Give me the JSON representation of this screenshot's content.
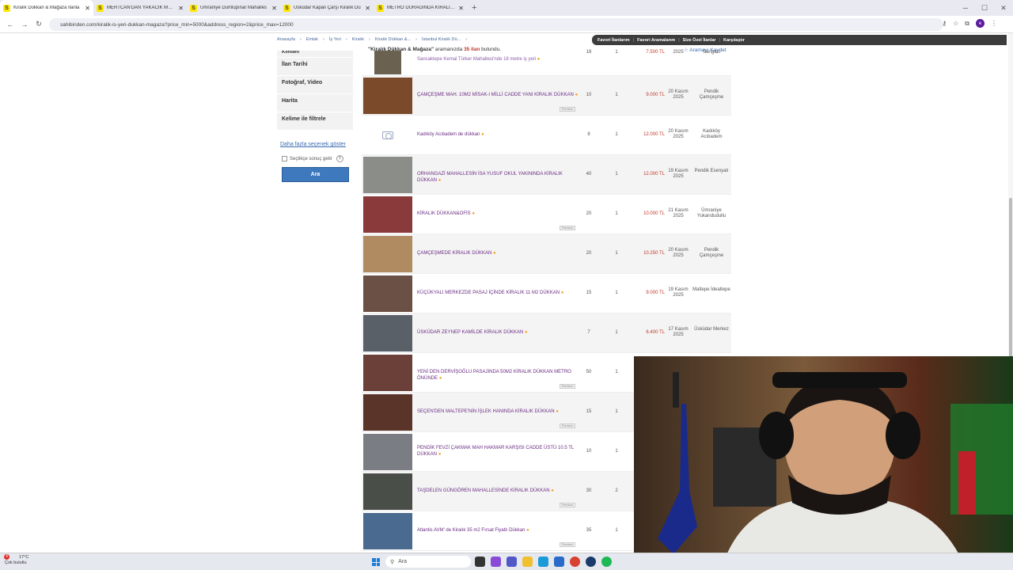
{
  "browser": {
    "tabs": [
      {
        "label": "Kiralık Dükkan & Mağaza İlanla",
        "active": true
      },
      {
        "label": "MERTCAN'DAN YAKACIK MEYD",
        "active": false
      },
      {
        "label": "Ümraniye Dumlupınar Mahalles",
        "active": false
      },
      {
        "label": "Üsküdar Kapalı Çarşı Kiralık Dü",
        "active": false
      },
      {
        "label": "METRO DURAĞINDA KİRALIK D",
        "active": false
      }
    ],
    "url": "sahibinden.com/kiralik-is-yeri-dukkan-magaza?price_min=5000&address_region=2&price_max=12000"
  },
  "breadcrumbs": [
    "Anasayfa",
    "Emlak",
    "İş Yeri",
    "Kiralık",
    "Kiralık Dükkan &...",
    "İstanbul Kiralık Dü..."
  ],
  "topbar": [
    "Favori İlanlarım",
    "Favori Aramalarım",
    "Size Özel İlanlar",
    "Karşılaştır"
  ],
  "result": {
    "query": "\"Kiralık Dükkan & Mağaza\"",
    "middle": "aramanızda",
    "count": "35 ilan",
    "suffix": "bulundu."
  },
  "save_search": "Aramayı Kaydet",
  "sidebar": {
    "items": [
      "Kimden",
      "İlan Tarihi",
      "Fotoğraf, Video",
      "Harita",
      "Kelime ile filtrele"
    ],
    "more_link": "Daha fazla seçenek göster",
    "checkbox_label": "Seçtikçe sonuç getir",
    "help": "?",
    "search_button": "Ara"
  },
  "listings": [
    {
      "title": "Sancaktepe Kemal Türker Mahallesi'nde 18 metre iş yeri",
      "m2": "18",
      "rooms": "1",
      "price": "7.500 TL",
      "date": "2025",
      "loc": "Sarıgazi",
      "photo": "#6a6150",
      "premium": ""
    },
    {
      "title": "ÇAMÇEŞME MAH. 10M2 MİSAK-I MİLLİ CADDE YANI KİRALIK DÜKKAN",
      "m2": "10",
      "rooms": "1",
      "price": "9.000 TL",
      "date": "20 Kasım 2025",
      "loc": "Pendik Çamçeşme",
      "photo": "#7a4a2a",
      "premium": "Premium"
    },
    {
      "title": "Kadıköy Acıbadem de dükkan",
      "m2": "8",
      "rooms": "1",
      "price": "12.000 TL",
      "date": "20 Kasım 2025",
      "loc": "Kadıköy Acıbadem",
      "photo": "",
      "premium": ""
    },
    {
      "title": "ORHANGAZİ MAHALLESİN İSA YUSUF OKUL YAKININDA KİRALIK DÜKKAN",
      "m2": "40",
      "rooms": "1",
      "price": "12.000 TL",
      "date": "19 Kasım 2025",
      "loc": "Pendik Esenyalı",
      "photo": "#8a8d88",
      "premium": ""
    },
    {
      "title": "KİRALIK DÜKKAN&OFİS",
      "m2": "20",
      "rooms": "1",
      "price": "10.000 TL",
      "date": "21 Kasım 2025",
      "loc": "Ümraniye Yukarıdudullu",
      "photo": "#8a3a3a",
      "premium": "Premium"
    },
    {
      "title": "ÇAMÇEŞMEDE KİRALIK DÜKKAN",
      "m2": "20",
      "rooms": "1",
      "price": "10.250 TL",
      "date": "20 Kasım 2025",
      "loc": "Pendik Çamçeşme",
      "photo": "#b08a60",
      "premium": ""
    },
    {
      "title": "KÜÇÜKYALI MERKEZDE PASAJ İÇİNDE KİRALIK 11 M2 DÜKKAN",
      "m2": "15",
      "rooms": "1",
      "price": "9.000 TL",
      "date": "19 Kasım 2025",
      "loc": "Maltepe İdealtepe",
      "photo": "#6a5045",
      "premium": ""
    },
    {
      "title": "ÜSKÜDAR ZEYNEP KAMİLDE KİRALIK DÜKKAN",
      "m2": "7",
      "rooms": "1",
      "price": "6.400 TL",
      "date": "17 Kasım 2025",
      "loc": "Üsküdar Merkez",
      "photo": "#5a6068",
      "premium": ""
    },
    {
      "title": "YENİ DEN DERVİŞOĞLU PASAJINDA 50M2 KİRALIK DÜKKAN METRO ÖNÜNDE",
      "m2": "50",
      "rooms": "1",
      "price": "",
      "date": "",
      "loc": "",
      "photo": "#6a4038",
      "premium": "Premium"
    },
    {
      "title": "SEÇEN'DEN MALTEPE'NİN İŞLEK HANINDA KİRALIK DÜKKAN",
      "m2": "15",
      "rooms": "1",
      "price": "",
      "date": "",
      "loc": "",
      "photo": "#5a3428",
      "premium": "Premium"
    },
    {
      "title": "PENDİK FEVZİ ÇAKMAK MAH HAKMAR KARŞISI CADDE ÜSTÜ 10.5 TL DÜKKAN",
      "m2": "10",
      "rooms": "1",
      "price": "",
      "date": "",
      "loc": "",
      "photo": "#7a7e84",
      "premium": ""
    },
    {
      "title": "TAŞDELEN GÜNGÖREN MAHALLESİNDE KİRALIK DÜKKAN",
      "m2": "30",
      "rooms": "2",
      "price": "",
      "date": "",
      "loc": "",
      "photo": "#4a4e48",
      "premium": "Premium"
    },
    {
      "title": "Atlantis AVM' de Kiralık 35 m2 Fırsat Fiyatlı Dükkan",
      "m2": "35",
      "rooms": "1",
      "price": "",
      "date": "",
      "loc": "",
      "photo": "#4a6a90",
      "premium": "Premium"
    }
  ],
  "taskbar": {
    "weather_temp": "17°C",
    "weather_desc": "Çok bulutlu",
    "badge": "4",
    "search": "Ara"
  },
  "colors": {
    "accent": "#3e78bd",
    "listing_title": "#6a2c83",
    "price": "#c0392b"
  }
}
